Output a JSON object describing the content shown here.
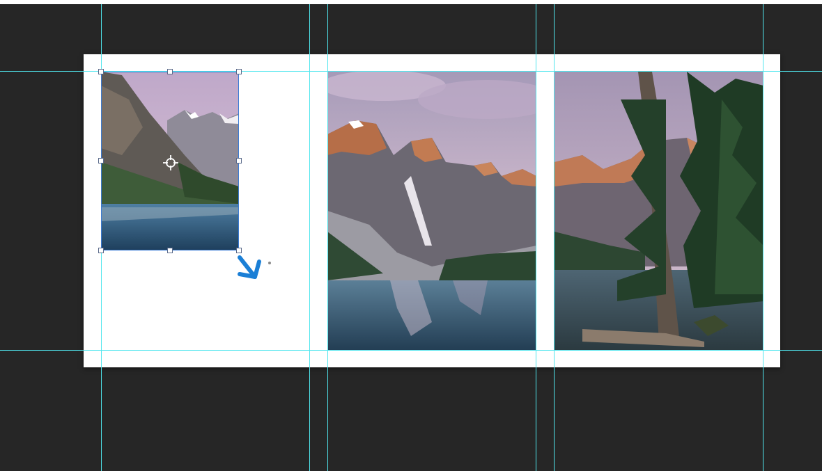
{
  "canvas": {
    "background_color": "#262626",
    "artboard_color": "#ffffff",
    "guide_color": "#4fe6ee",
    "selection_color": "#3a7bd5",
    "arrow_color": "#1b7fd6"
  },
  "photos": [
    {
      "scene": "mountain-lake-cliff",
      "selected": true
    },
    {
      "scene": "moraine-lake-peaks",
      "selected": false
    },
    {
      "scene": "forest-lakeshore",
      "selected": false
    }
  ],
  "icons": {
    "reference_point": "crosshair-icon",
    "drag_direction": "arrow-down-right-icon"
  }
}
